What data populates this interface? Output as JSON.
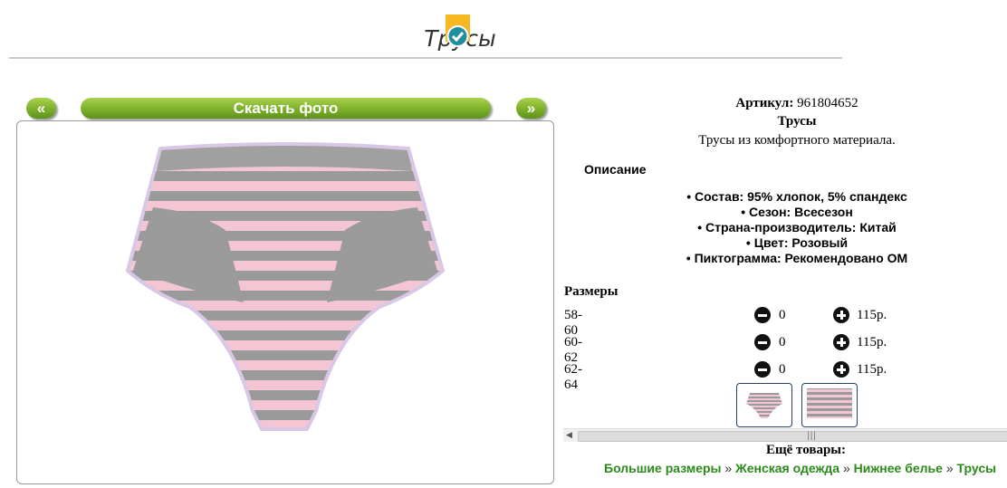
{
  "header": {
    "title": "Трусы"
  },
  "gallery": {
    "prev_label": "«",
    "download_label": "Скачать фото",
    "next_label": "»"
  },
  "product": {
    "article_label": "Артикул:",
    "article_value": "961804652",
    "name": "Трусы",
    "short_description": "Трусы из комфортного материала.",
    "description_heading": "Описание",
    "features": [
      "Состав: 95% хлопок, 5% спандекс",
      "Сезон: Всесезон",
      "Страна-производитель: Китай",
      "Цвет: Розовый",
      "Пиктограмма: Рекомендовано ОМ"
    ]
  },
  "sizes": {
    "heading": "Размеры",
    "rows": [
      {
        "size": "58-60",
        "qty": "0",
        "price": "115р."
      },
      {
        "size": "60-62",
        "qty": "0",
        "price": "115р."
      },
      {
        "size": "62-64",
        "qty": "0",
        "price": "115р."
      }
    ]
  },
  "more": {
    "heading": "Ещё товары:",
    "categories": [
      "Большие размеры",
      "Женская одежда",
      "Нижнее белье",
      "Трусы"
    ]
  },
  "colors": {
    "accent_green": "#7cb02a",
    "link_green": "#2a8a1a",
    "stripe_pink": "#f4c6d3",
    "stripe_gray": "#9a9a9a"
  }
}
